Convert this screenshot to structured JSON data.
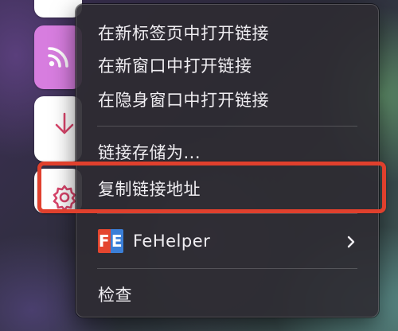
{
  "menu": {
    "items": [
      {
        "label": "在新标签页中打开链接"
      },
      {
        "label": "在新窗口中打开链接"
      },
      {
        "label": "在隐身窗口中打开链接"
      },
      {
        "label": "链接存储为..."
      },
      {
        "label": "复制链接地址"
      },
      {
        "label": "FeHelper",
        "logo_text": "FE",
        "icon": "fehelper-logo-icon",
        "submenu_icon": "chevron-right-icon"
      },
      {
        "label": "检查"
      }
    ]
  },
  "toolbar": {
    "icons": [
      "rss-icon",
      "download-arrow-icon",
      "gear-icon"
    ]
  },
  "colors": {
    "highlight": "#e0402d",
    "rss_tile": "#d77ddf",
    "icon_accent": "#d9456b",
    "fe_red": "#e4462f",
    "fe_blue": "#3b7fd8"
  }
}
